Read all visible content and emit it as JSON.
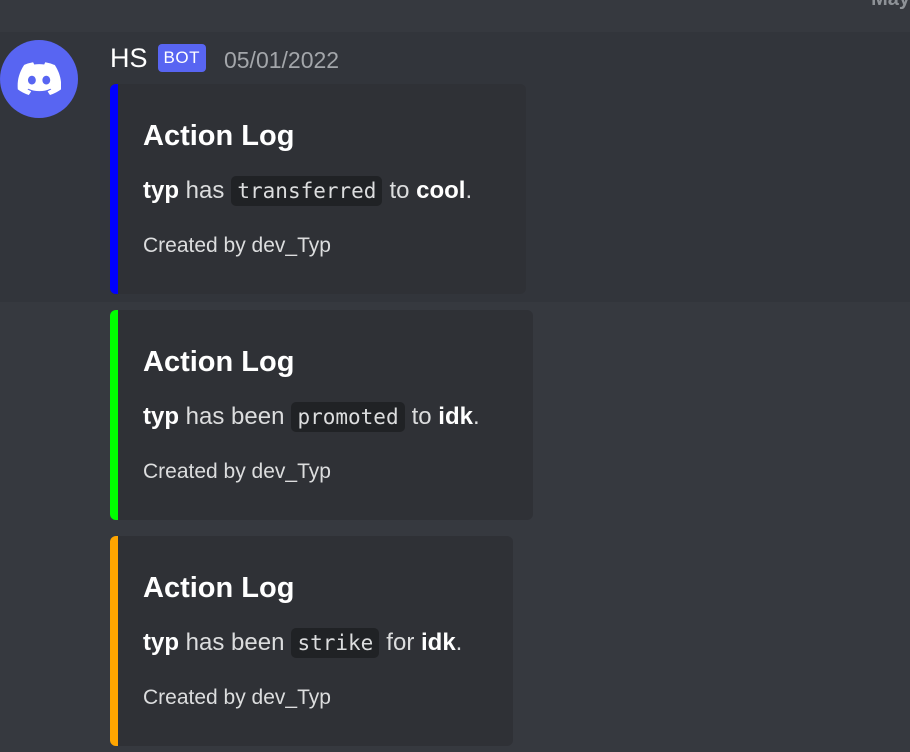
{
  "top_cut_label": "May",
  "message": {
    "username": "HS",
    "badge": "BOT",
    "timestamp": "05/01/2022",
    "avatar_icon": "discord-logo-icon",
    "avatar_color": "#5865f2"
  },
  "embeds": [
    {
      "color": "#0000ff",
      "title": "Action Log",
      "subject": "typ",
      "phrase": "has",
      "action": "transferred",
      "preposition": "to",
      "target": "cool",
      "end": ".",
      "footer": "Created by dev_Typ"
    },
    {
      "color": "#00ff00",
      "title": "Action Log",
      "subject": "typ",
      "phrase": "has been",
      "action": "promoted",
      "preposition": "to",
      "target": "idk",
      "end": ".",
      "footer": "Created by dev_Typ"
    },
    {
      "color": "#ffa500",
      "title": "Action Log",
      "subject": "typ",
      "phrase": "has been",
      "action": "strike",
      "preposition": "for",
      "target": "idk",
      "end": ".",
      "footer": "Created by dev_Typ"
    }
  ]
}
